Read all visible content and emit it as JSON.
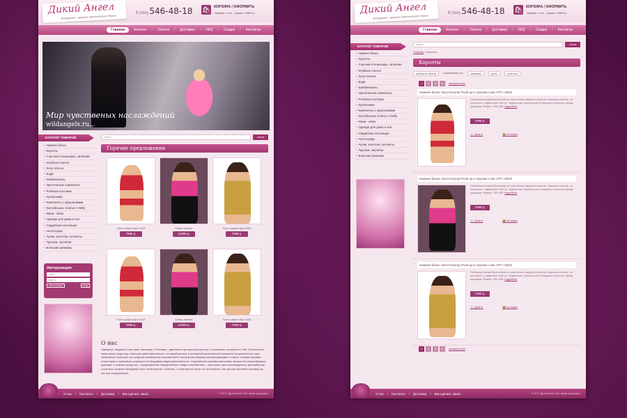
{
  "header": {
    "logo_title": "Дикий Ангел",
    "logo_subtitle": "Интернет - магазин эротического белья",
    "phone_code": "8 (xxx)",
    "phone_number": "546-48-18",
    "cart_title": "КОРЗИНА / ОФОРМИТЬ",
    "cart_count_label": "Товаров: 3 шт.",
    "cart_sum_label": "Сумма: 13589 р."
  },
  "nav": [
    "Главная",
    "Каталог",
    "Оплата",
    "Доставка",
    "FAQ",
    "Скидки",
    "Контакты"
  ],
  "banner": {
    "caption1": "Мир чувственых наслаждений",
    "caption2": "wildangels.ru..."
  },
  "catalog": {
    "title": "КАТАЛОГ ТОВАРОВ",
    "items": [
      "Нижнее белье",
      "Корсеты",
      "Сорочки и пеньюары, халатики",
      "Клубные платья",
      "Secy-платья",
      "Боди",
      "Комбинезоны",
      "Эротические комплекты",
      "Ролевые костюмы",
      "Купальники",
      "Комплекты с ферономами",
      "Коктейльные платья A.Nelly",
      "Мини - юбки",
      "Одежда для дома и сна",
      "Свадебная коллекция",
      "Аксессуары",
      "Чулки, колготки, леггинсы",
      "Трусики, перчатки",
      "Большие размеры"
    ]
  },
  "search": {
    "placeholder": "найти",
    "button": "поиск"
  },
  "hot": {
    "title": "Горячие предложения",
    "products": [
      {
        "name": "Топ и шорты Арт 0124",
        "price": "7099 р."
      },
      {
        "name": "Секси платья",
        "price": "12099 р."
      },
      {
        "name": "Топ и шорты Арт 0124",
        "price": "7099 р."
      },
      {
        "name": "Топ и шорты Арт 0124",
        "price": "7099 р."
      },
      {
        "name": "Секси платья",
        "price": "12099 р."
      },
      {
        "name": "Топ и шорты Арт 0124",
        "price": "7099 р."
      }
    ]
  },
  "auth": {
    "title": "Авторизация",
    "login": "логин",
    "password": "пароль",
    "register": "регистрация",
    "enter": "вход"
  },
  "about": {
    "title": "О нас",
    "text": "Наверное, каждый из нас знает поговорку: «Реклама – двигатель торговли (прогресса)», и возможно согласится с ней. Она вошла в нашу жизнь тогда еще советскую действительность, но яркий рассвет в рекламной деятельности пришелся на девяностые годы. Изначально трактуясь как средство оповещения покупателей и наилучшим образом рассказывающим о товаре, сегодня реклама стала также и значимым социально необходимым видом деятельности. Современная реклама выполняет множество разнообразных функций, и главная среди них – представление определённого товара потребителю – она играет роль производителя, дистрибутора и учителя, получая наглядный опыт «этой власти». Конечно, с этим многие могут не согласиться, так как сам феномен рекламы до сих пор неоднозначен."
  },
  "footer": {
    "links": [
      "О нас",
      "Контакты",
      "Доставка",
      "Как сделать заказ"
    ],
    "copyright": "© 2011 \"Дикий ангел\" Все права защищены"
  },
  "page2": {
    "breadcrumb_home": "Главная",
    "breadcrumb_current": "Корсеты",
    "section_title": "Корсеты",
    "filters": {
      "label": "Сортировать по:",
      "brand": "выберите бренд",
      "name": "название",
      "price": "цена",
      "popularity": "рейтингу"
    },
    "pages": [
      "1",
      "2",
      "3",
      "4"
    ],
    "show_all": "показать все",
    "items": [
      {
        "title": "Нижнее белье: Бюстгальтер Push-up и трусики слип АРТ. L0023",
        "desc": "Соблазнительный бюстгальтер из эластичного ажурного полотна. Чашечки плотные, на косточках, с эффектом Push-up. Эффектные трусики-слип из ажурного полотна с ярким кружевом. Размер: 75B, 80B.",
        "more": "подробнее",
        "price": "7099 р.",
        "buy": "купить",
        "order": "на заказ"
      },
      {
        "title": "Нижнее белье: Бюстгальтер Push-up и трусики слип АРТ. L0023",
        "desc": "Соблазнительный бюстгальтер из эластичного ажурного полотна. Чашечки плотные, на косточках, с эффектом Push-up. Эффектные трусики-слип из ажурного полотна с ярким кружевом. Размер: 75B, 80B.",
        "more": "подробнее",
        "price": "7099 р.",
        "buy": "купить",
        "order": "на заказ"
      },
      {
        "title": "Нижнее белье: Бюстгальтер Push-up и трусики слип АРТ. L0023",
        "desc": "Соблазнительный бюстгальтер из эластичного ажурного полотна. Чашечки плотные, на косточках, с эффектом Push-up. Эффектные трусики-слип из ажурного полотна с ярким кружевом. Размер: 75B, 80B.",
        "more": "подробнее",
        "price": "7099 р.",
        "buy": "купить",
        "order": "на заказ"
      }
    ]
  }
}
